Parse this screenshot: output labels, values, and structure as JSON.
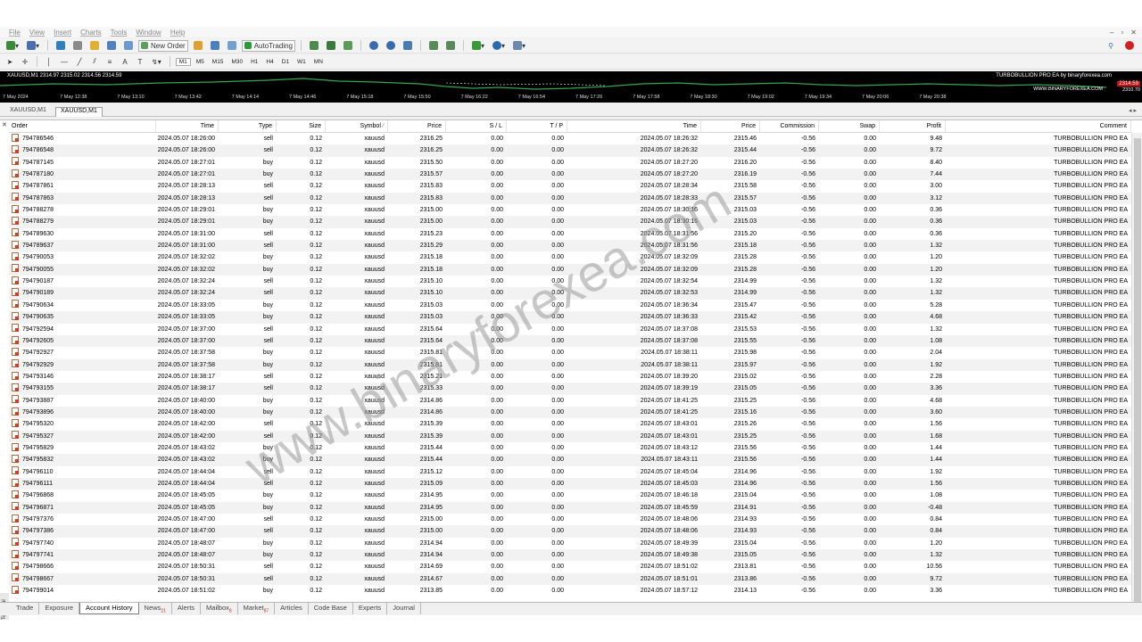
{
  "menu": [
    "File",
    "View",
    "Insert",
    "Charts",
    "Tools",
    "Window",
    "Help"
  ],
  "toolbar": {
    "new_order_label": "New Order",
    "autotrading_label": "AutoTrading",
    "timeframes": [
      "M1",
      "M5",
      "M15",
      "M30",
      "H1",
      "H4",
      "D1",
      "W1",
      "MN"
    ]
  },
  "chart": {
    "title": "XAUUSD,M1 2314.97 2315.02 2314.56 2314.59",
    "brand": "TURBOBULLION PRO EA by binaryforexea.com",
    "website": "WWW.BINARYFOREXEA.COM",
    "price_tag": "2314.59",
    "price_level": "2310.70",
    "time_labels": [
      "7 May 2024",
      "7 May 12:38",
      "7 May 13:10",
      "7 May 13:42",
      "7 May 14:14",
      "7 May 14:46",
      "7 May 15:18",
      "7 May 15:50",
      "7 May 16:22",
      "7 May 16:54",
      "7 May 17:26",
      "7 May 17:58",
      "7 May 18:30",
      "7 May 19:02",
      "7 May 19:34",
      "7 May 20:06",
      "7 May 20:38"
    ]
  },
  "chart_tabs": [
    "XAUUSD,M1",
    "XAUUSD,M1"
  ],
  "columns": {
    "order": "Order",
    "open_time": "Time",
    "type": "Type",
    "size": "Size",
    "symbol": "Symbol",
    "open_price": "Price",
    "sl": "S / L",
    "tp": "T / P",
    "close_time": "Time",
    "close_price": "Price",
    "commission": "Commission",
    "swap": "Swap",
    "profit": "Profit",
    "comment": "Comment"
  },
  "rows": [
    [
      "794786546",
      "2024.05.07 18:26:00",
      "sell",
      "0.12",
      "xauusd",
      "2316.25",
      "0.00",
      "0.00",
      "2024.05.07 18:26:32",
      "2315.46",
      "-0.56",
      "0.00",
      "9.48",
      "TURBOBULLION PRO EA"
    ],
    [
      "794786548",
      "2024.05.07 18:26:00",
      "sell",
      "0.12",
      "xauusd",
      "2316.25",
      "0.00",
      "0.00",
      "2024.05.07 18:26:32",
      "2315.44",
      "-0.56",
      "0.00",
      "9.72",
      "TURBOBULLION PRO EA"
    ],
    [
      "794787145",
      "2024.05.07 18:27:01",
      "buy",
      "0.12",
      "xauusd",
      "2315.50",
      "0.00",
      "0.00",
      "2024.05.07 18:27:20",
      "2316.20",
      "-0.56",
      "0.00",
      "8.40",
      "TURBOBULLION PRO EA"
    ],
    [
      "794787180",
      "2024.05.07 18:27:01",
      "buy",
      "0.12",
      "xauusd",
      "2315.57",
      "0.00",
      "0.00",
      "2024.05.07 18:27:20",
      "2316.19",
      "-0.56",
      "0.00",
      "7.44",
      "TURBOBULLION PRO EA"
    ],
    [
      "794787861",
      "2024.05.07 18:28:13",
      "sell",
      "0.12",
      "xauusd",
      "2315.83",
      "0.00",
      "0.00",
      "2024.05.07 18:28:34",
      "2315.58",
      "-0.56",
      "0.00",
      "3.00",
      "TURBOBULLION PRO EA"
    ],
    [
      "794787863",
      "2024.05.07 18:28:13",
      "sell",
      "0.12",
      "xauusd",
      "2315.83",
      "0.00",
      "0.00",
      "2024.05.07 18:28:33",
      "2315.57",
      "-0.56",
      "0.00",
      "3.12",
      "TURBOBULLION PRO EA"
    ],
    [
      "794788278",
      "2024.05.07 18:29:01",
      "buy",
      "0.12",
      "xauusd",
      "2315.00",
      "0.00",
      "0.00",
      "2024.05.07 18:30:16",
      "2315.03",
      "-0.56",
      "0.00",
      "0.36",
      "TURBOBULLION PRO EA"
    ],
    [
      "794788279",
      "2024.05.07 18:29:01",
      "buy",
      "0.12",
      "xauusd",
      "2315.00",
      "0.00",
      "0.00",
      "2024.05.07 18:30:16",
      "2315.03",
      "-0.56",
      "0.00",
      "0.36",
      "TURBOBULLION PRO EA"
    ],
    [
      "794789630",
      "2024.05.07 18:31:00",
      "sell",
      "0.12",
      "xauusd",
      "2315.23",
      "0.00",
      "0.00",
      "2024.05.07 18:31:56",
      "2315.20",
      "-0.56",
      "0.00",
      "0.36",
      "TURBOBULLION PRO EA"
    ],
    [
      "794789637",
      "2024.05.07 18:31:00",
      "sell",
      "0.12",
      "xauusd",
      "2315.29",
      "0.00",
      "0.00",
      "2024.05.07 18:31:56",
      "2315.18",
      "-0.56",
      "0.00",
      "1.32",
      "TURBOBULLION PRO EA"
    ],
    [
      "794790053",
      "2024.05.07 18:32:02",
      "buy",
      "0.12",
      "xauusd",
      "2315.18",
      "0.00",
      "0.00",
      "2024.05.07 18:32:09",
      "2315.28",
      "-0.56",
      "0.00",
      "1.20",
      "TURBOBULLION PRO EA"
    ],
    [
      "794790055",
      "2024.05.07 18:32:02",
      "buy",
      "0.12",
      "xauusd",
      "2315.18",
      "0.00",
      "0.00",
      "2024.05.07 18:32:09",
      "2315.28",
      "-0.56",
      "0.00",
      "1.20",
      "TURBOBULLION PRO EA"
    ],
    [
      "794790187",
      "2024.05.07 18:32:24",
      "sell",
      "0.12",
      "xauusd",
      "2315.10",
      "0.00",
      "0.00",
      "2024.05.07 18:32:54",
      "2314.99",
      "-0.56",
      "0.00",
      "1.32",
      "TURBOBULLION PRO EA"
    ],
    [
      "794790189",
      "2024.05.07 18:32:24",
      "sell",
      "0.12",
      "xauusd",
      "2315.10",
      "0.00",
      "0.00",
      "2024.05.07 18:32:53",
      "2314.99",
      "-0.56",
      "0.00",
      "1.32",
      "TURBOBULLION PRO EA"
    ],
    [
      "794790634",
      "2024.05.07 18:33:05",
      "buy",
      "0.12",
      "xauusd",
      "2315.03",
      "0.00",
      "0.00",
      "2024.05.07 18:36:34",
      "2315.47",
      "-0.56",
      "0.00",
      "5.28",
      "TURBOBULLION PRO EA"
    ],
    [
      "794790635",
      "2024.05.07 18:33:05",
      "buy",
      "0.12",
      "xauusd",
      "2315.03",
      "0.00",
      "0.00",
      "2024.05.07 18:36:33",
      "2315.42",
      "-0.56",
      "0.00",
      "4.68",
      "TURBOBULLION PRO EA"
    ],
    [
      "794792594",
      "2024.05.07 18:37:00",
      "sell",
      "0.12",
      "xauusd",
      "2315.64",
      "0.00",
      "0.00",
      "2024.05.07 18:37:08",
      "2315.53",
      "-0.56",
      "0.00",
      "1.32",
      "TURBOBULLION PRO EA"
    ],
    [
      "794792605",
      "2024.05.07 18:37:00",
      "sell",
      "0.12",
      "xauusd",
      "2315.64",
      "0.00",
      "0.00",
      "2024.05.07 18:37:08",
      "2315.55",
      "-0.56",
      "0.00",
      "1.08",
      "TURBOBULLION PRO EA"
    ],
    [
      "794792927",
      "2024.05.07 18:37:58",
      "buy",
      "0.12",
      "xauusd",
      "2315.81",
      "0.00",
      "0.00",
      "2024.05.07 18:38:11",
      "2315.98",
      "-0.56",
      "0.00",
      "2.04",
      "TURBOBULLION PRO EA"
    ],
    [
      "794792929",
      "2024.05.07 18:37:58",
      "buy",
      "0.12",
      "xauusd",
      "2315.81",
      "0.00",
      "0.00",
      "2024.05.07 18:38:11",
      "2315.97",
      "-0.56",
      "0.00",
      "1.92",
      "TURBOBULLION PRO EA"
    ],
    [
      "794793146",
      "2024.05.07 18:38:17",
      "sell",
      "0.12",
      "xauusd",
      "2315.21",
      "0.00",
      "0.00",
      "2024.05.07 18:39:20",
      "2315.02",
      "-0.56",
      "0.00",
      "2.28",
      "TURBOBULLION PRO EA"
    ],
    [
      "794793155",
      "2024.05.07 18:38:17",
      "sell",
      "0.12",
      "xauusd",
      "2315.33",
      "0.00",
      "0.00",
      "2024.05.07 18:39:19",
      "2315.05",
      "-0.56",
      "0.00",
      "3.36",
      "TURBOBULLION PRO EA"
    ],
    [
      "794793887",
      "2024.05.07 18:40:00",
      "buy",
      "0.12",
      "xauusd",
      "2314.86",
      "0.00",
      "0.00",
      "2024.05.07 18:41:25",
      "2315.25",
      "-0.56",
      "0.00",
      "4.68",
      "TURBOBULLION PRO EA"
    ],
    [
      "794793896",
      "2024.05.07 18:40:00",
      "buy",
      "0.12",
      "xauusd",
      "2314.86",
      "0.00",
      "0.00",
      "2024.05.07 18:41:25",
      "2315.16",
      "-0.56",
      "0.00",
      "3.60",
      "TURBOBULLION PRO EA"
    ],
    [
      "794795320",
      "2024.05.07 18:42:00",
      "sell",
      "0.12",
      "xauusd",
      "2315.39",
      "0.00",
      "0.00",
      "2024.05.07 18:43:01",
      "2315.26",
      "-0.56",
      "0.00",
      "1.56",
      "TURBOBULLION PRO EA"
    ],
    [
      "794795327",
      "2024.05.07 18:42:00",
      "sell",
      "0.12",
      "xauusd",
      "2315.39",
      "0.00",
      "0.00",
      "2024.05.07 18:43:01",
      "2315.25",
      "-0.56",
      "0.00",
      "1.68",
      "TURBOBULLION PRO EA"
    ],
    [
      "794795829",
      "2024.05.07 18:43:02",
      "buy",
      "0.12",
      "xauusd",
      "2315.44",
      "0.00",
      "0.00",
      "2024.05.07 18:43:12",
      "2315.56",
      "-0.56",
      "0.00",
      "1.44",
      "TURBOBULLION PRO EA"
    ],
    [
      "794795832",
      "2024.05.07 18:43:02",
      "buy",
      "0.12",
      "xauusd",
      "2315.44",
      "0.00",
      "0.00",
      "2024.05.07 18:43:11",
      "2315.56",
      "-0.56",
      "0.00",
      "1.44",
      "TURBOBULLION PRO EA"
    ],
    [
      "794796110",
      "2024.05.07 18:44:04",
      "sell",
      "0.12",
      "xauusd",
      "2315.12",
      "0.00",
      "0.00",
      "2024.05.07 18:45:04",
      "2314.96",
      "-0.56",
      "0.00",
      "1.92",
      "TURBOBULLION PRO EA"
    ],
    [
      "794796111",
      "2024.05.07 18:44:04",
      "sell",
      "0.12",
      "xauusd",
      "2315.09",
      "0.00",
      "0.00",
      "2024.05.07 18:45:03",
      "2314.96",
      "-0.56",
      "0.00",
      "1.56",
      "TURBOBULLION PRO EA"
    ],
    [
      "794796868",
      "2024.05.07 18:45:05",
      "buy",
      "0.12",
      "xauusd",
      "2314.95",
      "0.00",
      "0.00",
      "2024.05.07 18:46:18",
      "2315.04",
      "-0.56",
      "0.00",
      "1.08",
      "TURBOBULLION PRO EA"
    ],
    [
      "794796871",
      "2024.05.07 18:45:05",
      "buy",
      "0.12",
      "xauusd",
      "2314.95",
      "0.00",
      "0.00",
      "2024.05.07 18:45:59",
      "2314.91",
      "-0.56",
      "0.00",
      "-0.48",
      "TURBOBULLION PRO EA"
    ],
    [
      "794797376",
      "2024.05.07 18:47:00",
      "sell",
      "0.12",
      "xauusd",
      "2315.00",
      "0.00",
      "0.00",
      "2024.05.07 18:48:06",
      "2314.93",
      "-0.56",
      "0.00",
      "0.84",
      "TURBOBULLION PRO EA"
    ],
    [
      "794797386",
      "2024.05.07 18:47:00",
      "sell",
      "0.12",
      "xauusd",
      "2315.00",
      "0.00",
      "0.00",
      "2024.05.07 18:48:06",
      "2314.93",
      "-0.56",
      "0.00",
      "0.84",
      "TURBOBULLION PRO EA"
    ],
    [
      "794797740",
      "2024.05.07 18:48:07",
      "buy",
      "0.12",
      "xauusd",
      "2314.94",
      "0.00",
      "0.00",
      "2024.05.07 18:49:39",
      "2315.04",
      "-0.56",
      "0.00",
      "1.20",
      "TURBOBULLION PRO EA"
    ],
    [
      "794797741",
      "2024.05.07 18:48:07",
      "buy",
      "0.12",
      "xauusd",
      "2314.94",
      "0.00",
      "0.00",
      "2024.05.07 18:49:38",
      "2315.05",
      "-0.56",
      "0.00",
      "1.32",
      "TURBOBULLION PRO EA"
    ],
    [
      "794798666",
      "2024.05.07 18:50:31",
      "sell",
      "0.12",
      "xauusd",
      "2314.69",
      "0.00",
      "0.00",
      "2024.05.07 18:51:02",
      "2313.81",
      "-0.56",
      "0.00",
      "10.56",
      "TURBOBULLION PRO EA"
    ],
    [
      "794798667",
      "2024.05.07 18:50:31",
      "sell",
      "0.12",
      "xauusd",
      "2314.67",
      "0.00",
      "0.00",
      "2024.05.07 18:51:01",
      "2313.86",
      "-0.56",
      "0.00",
      "9.72",
      "TURBOBULLION PRO EA"
    ],
    [
      "794799014",
      "2024.05.07 18:51:02",
      "buy",
      "0.12",
      "xauusd",
      "2313.85",
      "0.00",
      "0.00",
      "2024.05.07 18:57:12",
      "2314.13",
      "-0.56",
      "0.00",
      "3.36",
      "TURBOBULLION PRO EA"
    ]
  ],
  "terminal_label": "Terminal",
  "bottom_tabs": [
    {
      "label": "Trade",
      "badge": ""
    },
    {
      "label": "Exposure",
      "badge": ""
    },
    {
      "label": "Account History",
      "badge": ""
    },
    {
      "label": "News",
      "badge": "21"
    },
    {
      "label": "Alerts",
      "badge": ""
    },
    {
      "label": "Mailbox",
      "badge": "8"
    },
    {
      "label": "Market",
      "badge": "87"
    },
    {
      "label": "Articles",
      "badge": ""
    },
    {
      "label": "Code Base",
      "badge": ""
    },
    {
      "label": "Experts",
      "badge": ""
    },
    {
      "label": "Journal",
      "badge": ""
    }
  ],
  "active_bottom_tab": "Account History",
  "watermark": "www.binaryforexea.com",
  "colors": {
    "chart_bg": "#000000",
    "price_tag": "#c81010",
    "accent_icon": "#d43c1c"
  }
}
